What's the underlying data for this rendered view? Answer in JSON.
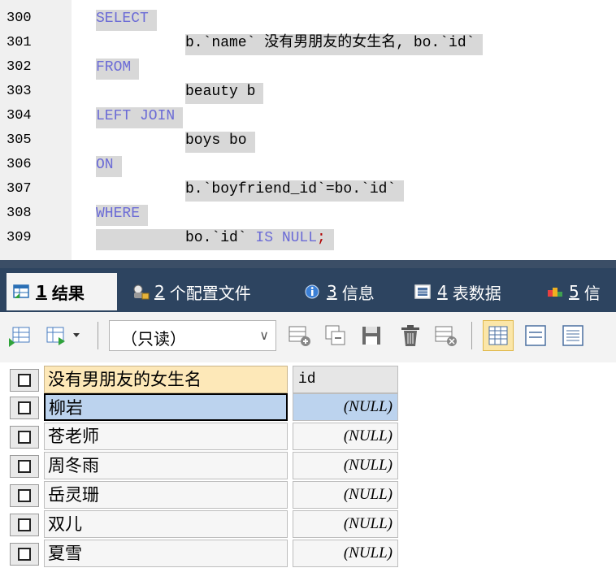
{
  "editor": {
    "lines": [
      {
        "num": "300",
        "kw": "SELECT"
      },
      {
        "num": "301",
        "pre": "b.`name` 没有男朋友的女生名, bo.`id`"
      },
      {
        "num": "302",
        "kw": "FROM"
      },
      {
        "num": "303",
        "pre": "beauty b"
      },
      {
        "num": "304",
        "kw": "LEFT JOIN"
      },
      {
        "num": "305",
        "pre": "boys bo"
      },
      {
        "num": "306",
        "kw": "ON"
      },
      {
        "num": "307",
        "pre": "b.`boyfriend_id`=bo.`id`"
      },
      {
        "num": "308",
        "kw": "WHERE"
      },
      {
        "num": "309",
        "pre": "bo.`id` ",
        "kw2": "IS NULL",
        "tail": ";"
      }
    ],
    "colors": {
      "keyword": "#6b6bd6",
      "selection": "#d8d8d8",
      "semicolon": "#b00000"
    }
  },
  "tabs": [
    {
      "num": "1",
      "label": "结果",
      "icon": "result-grid-icon",
      "active": true
    },
    {
      "num": "2",
      "label": "个配置文件",
      "icon": "profile-icon",
      "active": false
    },
    {
      "num": "3",
      "label": "信息",
      "icon": "info-icon",
      "active": false
    },
    {
      "num": "4",
      "label": "表数据",
      "icon": "table-data-icon",
      "active": false
    },
    {
      "num": "5",
      "label": "信",
      "icon": "history-icon",
      "active": false
    }
  ],
  "toolbar": {
    "mode_select": "（只读）",
    "icons": [
      "export-icon",
      "import-dropdown-icon",
      "insert-row-icon",
      "duplicate-row-icon",
      "save-icon",
      "delete-icon",
      "refresh-icon",
      "grid-view-icon",
      "form-view-icon",
      "text-view-icon"
    ]
  },
  "result": {
    "columns": [
      "没有男朋友的女生名",
      "id"
    ],
    "rows": [
      [
        "柳岩",
        "(NULL)"
      ],
      [
        "苍老师",
        "(NULL)"
      ],
      [
        "周冬雨",
        "(NULL)"
      ],
      [
        "岳灵珊",
        "(NULL)"
      ],
      [
        "双儿",
        "(NULL)"
      ],
      [
        "夏雪",
        "(NULL)"
      ]
    ],
    "selected_row": 0
  }
}
